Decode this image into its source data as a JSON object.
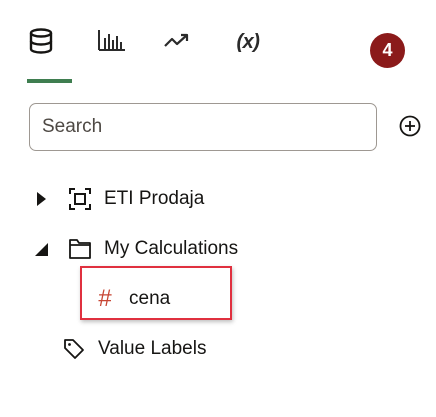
{
  "tabs": [
    {
      "name": "data",
      "icon": "database-icon"
    },
    {
      "name": "visualizations",
      "icon": "bar-chart-icon"
    },
    {
      "name": "analytics",
      "icon": "trend-icon"
    },
    {
      "name": "calculations",
      "label": "(x)"
    }
  ],
  "active_tab": "data",
  "badge": {
    "text": "4",
    "color": "#8b1a1a"
  },
  "search": {
    "placeholder": "Search",
    "value": ""
  },
  "add_icon": "plus-circle-icon",
  "tree": {
    "eti_prodaja": {
      "label": "ETI Prodaja",
      "icon": "subject-area-icon",
      "expanded": false
    },
    "my_calculations": {
      "label": "My Calculations",
      "icon": "folder-icon",
      "expanded": true,
      "children": [
        {
          "symbol": "#",
          "label": "cena",
          "highlighted": true
        }
      ]
    },
    "value_labels": {
      "label": "Value Labels",
      "icon": "tag-icon"
    }
  },
  "colors": {
    "accent_underline": "#3f7e50",
    "hash_symbol": "#c74634",
    "highlight_border": "#e0303f"
  }
}
